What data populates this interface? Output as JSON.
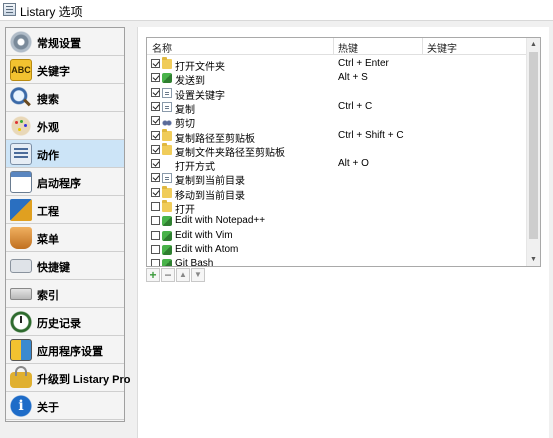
{
  "window": {
    "title": "Listary 选项"
  },
  "sidebar": {
    "selected_index": 4,
    "items": [
      {
        "label": "常规设置",
        "icon": "gear-icon"
      },
      {
        "label": "关键字",
        "icon": "abc-keyword-icon",
        "icon_text": "ABC"
      },
      {
        "label": "搜索",
        "icon": "magnifier-icon"
      },
      {
        "label": "外观",
        "icon": "palette-icon"
      },
      {
        "label": "动作",
        "icon": "action-list-icon"
      },
      {
        "label": "启动程序",
        "icon": "window-icon"
      },
      {
        "label": "工程",
        "icon": "blocks-icon"
      },
      {
        "label": "菜单",
        "icon": "basket-icon"
      },
      {
        "label": "快捷键",
        "icon": "keyboard-icon"
      },
      {
        "label": "索引",
        "icon": "drive-icon"
      },
      {
        "label": "历史记录",
        "icon": "clock-icon"
      },
      {
        "label": "应用程序设置",
        "icon": "apps-icon"
      },
      {
        "label": "升级到 Listary Pro",
        "icon": "lock-icon"
      },
      {
        "label": "关于",
        "icon": "info-icon",
        "icon_text": "i"
      }
    ]
  },
  "actions_table": {
    "columns": [
      "名称",
      "热键",
      "关键字"
    ],
    "rows": [
      {
        "checked": true,
        "icon": "folder-icon",
        "name": "打开文件夹",
        "hotkey": "Ctrl + Enter",
        "keyword": ""
      },
      {
        "checked": true,
        "icon": "send-icon",
        "name": "发送到",
        "hotkey": "Alt + S",
        "keyword": ""
      },
      {
        "checked": true,
        "icon": "page-icon",
        "name": "设置关键字",
        "hotkey": "",
        "keyword": ""
      },
      {
        "checked": true,
        "icon": "copy-icon",
        "name": "复制",
        "hotkey": "Ctrl + C",
        "keyword": ""
      },
      {
        "checked": true,
        "icon": "scissors-icon",
        "name": "剪切",
        "hotkey": "",
        "keyword": ""
      },
      {
        "checked": true,
        "icon": "copy-path-icon",
        "name": "复制路径至剪贴板",
        "hotkey": "Ctrl + Shift + C",
        "keyword": ""
      },
      {
        "checked": true,
        "icon": "copy-folder-path-icon",
        "name": "复制文件夹路径至剪贴板",
        "hotkey": "",
        "keyword": ""
      },
      {
        "checked": true,
        "icon": "",
        "name": "打开方式",
        "hotkey": "Alt + O",
        "keyword": ""
      },
      {
        "checked": true,
        "icon": "page-icon",
        "name": "复制到当前目录",
        "hotkey": "",
        "keyword": ""
      },
      {
        "checked": true,
        "icon": "move-icon",
        "name": "移动到当前目录",
        "hotkey": "",
        "keyword": ""
      },
      {
        "checked": false,
        "icon": "folder-icon",
        "name": "打开",
        "hotkey": "",
        "keyword": ""
      },
      {
        "checked": false,
        "icon": "puzzle-icon",
        "name": "Edit with Notepad++",
        "hotkey": "",
        "keyword": ""
      },
      {
        "checked": false,
        "icon": "puzzle-icon",
        "name": "Edit with Vim",
        "hotkey": "",
        "keyword": ""
      },
      {
        "checked": false,
        "icon": "puzzle-icon",
        "name": "Edit with Atom",
        "hotkey": "",
        "keyword": ""
      },
      {
        "checked": false,
        "icon": "puzzle-icon",
        "name": "Git Bash",
        "hotkey": "",
        "keyword": ""
      }
    ]
  },
  "scrollbar": {
    "up_glyph": "▲",
    "down_glyph": "▼"
  },
  "toolbar": {
    "add_glyph": "+",
    "remove_glyph": "−",
    "up_glyph": "▲",
    "down_glyph": "▼"
  }
}
